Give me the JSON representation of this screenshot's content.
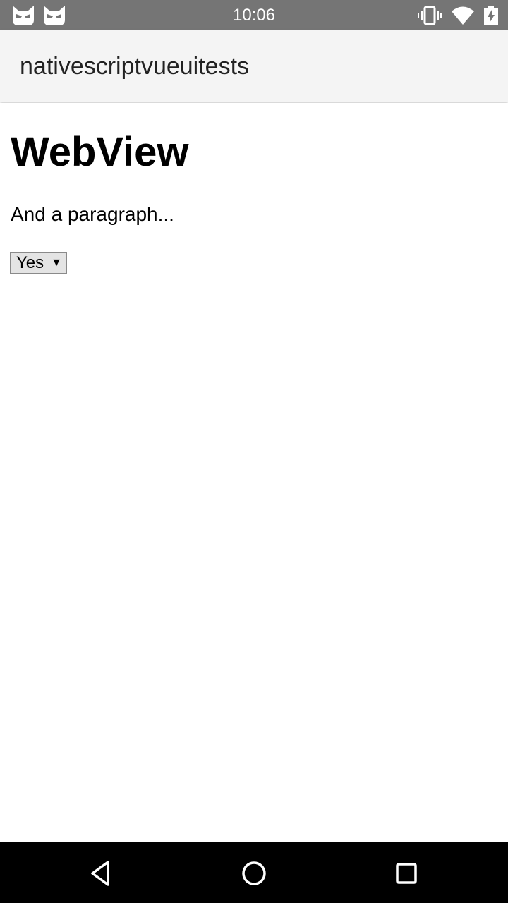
{
  "status_bar": {
    "time": "10:06",
    "left_icons": [
      "cyanogen-cat-icon",
      "cyanogen-cat-icon"
    ],
    "right_icons": [
      "vibrate-icon",
      "wifi-icon",
      "battery-charging-icon"
    ]
  },
  "action_bar": {
    "title": "nativescriptvueuitests"
  },
  "web_view": {
    "heading": "WebView",
    "paragraph": "And a paragraph...",
    "select": {
      "selected": "Yes",
      "arrow": "▼"
    }
  },
  "nav_bar": {
    "buttons": [
      "back-icon",
      "home-icon",
      "recents-icon"
    ]
  },
  "colors": {
    "status_bar": "#757575",
    "action_bar": "#f4f4f4",
    "nav_bar": "#000000",
    "page_background": "#ffffff"
  }
}
